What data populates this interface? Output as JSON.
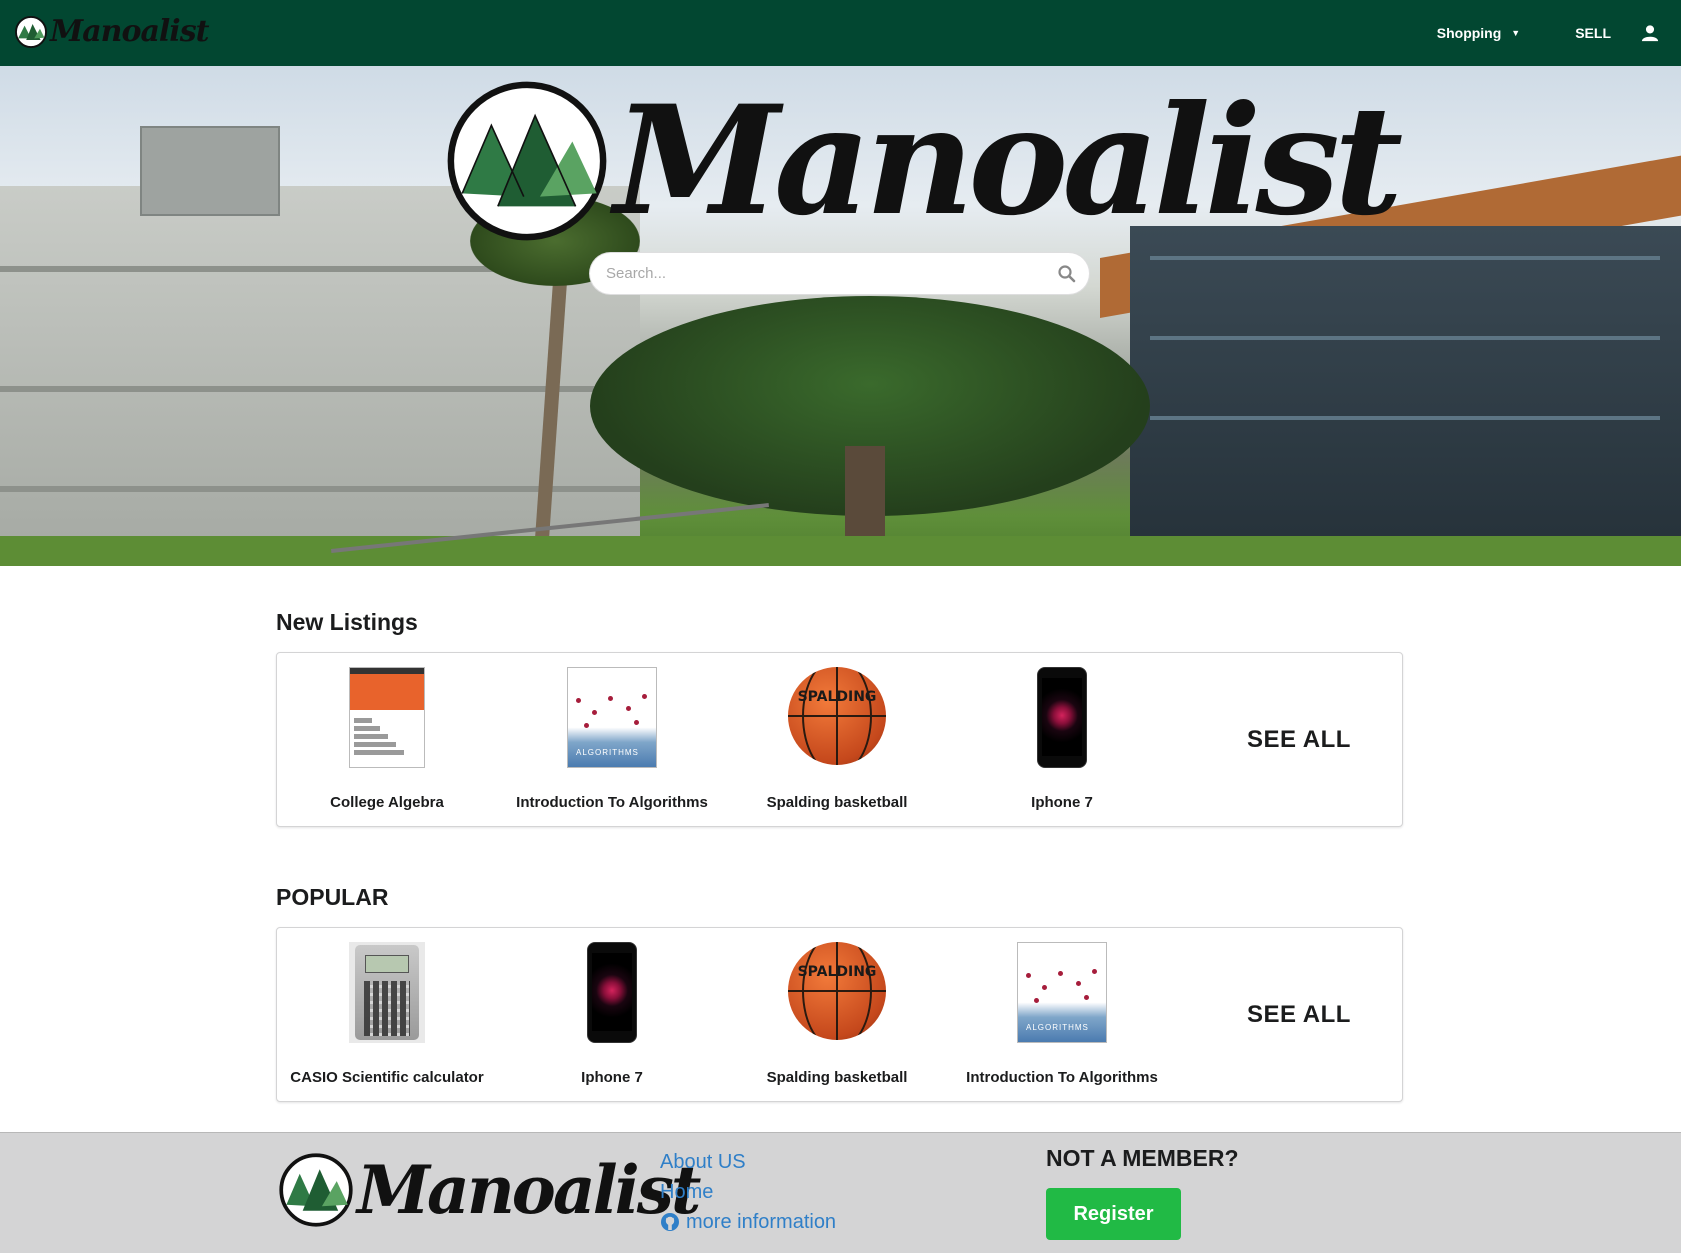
{
  "navbar": {
    "brand": "Manoalist",
    "shopping_label": "Shopping",
    "sell_label": "SELL",
    "icons": {
      "dropdown": "caret-down-icon",
      "user": "user-icon"
    },
    "bg_color": "#024731"
  },
  "hero": {
    "brand": "Manoalist",
    "search": {
      "placeholder": "Search...",
      "value": ""
    },
    "icons": {
      "search": "search-icon"
    }
  },
  "new_listings": {
    "title": "New Listings",
    "items": [
      {
        "label": "College Algebra",
        "thumb": "book-cover"
      },
      {
        "label": "Introduction To Algorithms",
        "thumb": "book-cover"
      },
      {
        "label": "Spalding basketball",
        "thumb": "basketball"
      },
      {
        "label": "Iphone 7",
        "thumb": "phone"
      }
    ],
    "see_all": "SEE ALL"
  },
  "popular": {
    "title": "POPULAR",
    "items": [
      {
        "label": "CASIO Scientific calculator",
        "thumb": "calculator"
      },
      {
        "label": "Iphone 7",
        "thumb": "phone"
      },
      {
        "label": "Spalding basketball",
        "thumb": "basketball"
      },
      {
        "label": "Introduction To Algorithms",
        "thumb": "book-cover"
      }
    ],
    "see_all": "SEE ALL"
  },
  "thumb_text": {
    "basketball_brand": "SPALDING",
    "algorithms_cover": "ALGORITHMS"
  },
  "footer": {
    "brand": "Manoalist",
    "links": [
      {
        "label": "About US"
      },
      {
        "label": "Home"
      },
      {
        "label": "more information",
        "icon": "github-icon"
      }
    ],
    "not_member": "NOT A MEMBER?",
    "register_label": "Register",
    "link_color": "#2f7fc8",
    "register_color": "#21ba45"
  }
}
